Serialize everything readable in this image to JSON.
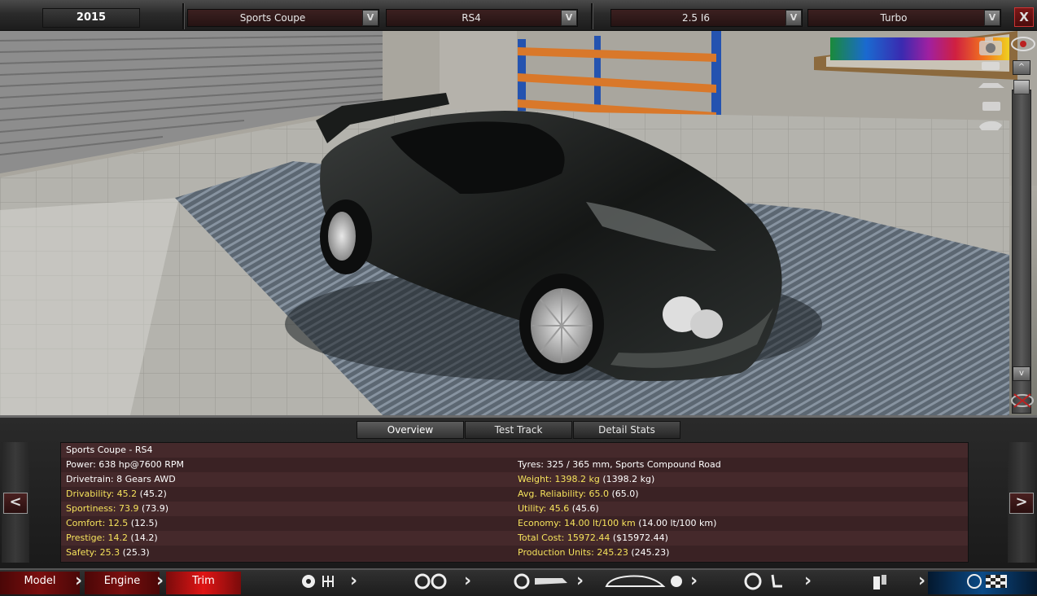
{
  "topbar": {
    "year": "2015",
    "selects": [
      {
        "value": "Sports Coupe",
        "arrow": "V"
      },
      {
        "value": "RS4",
        "arrow": "V"
      },
      {
        "value": "2.5 I6",
        "arrow": "V"
      },
      {
        "value": "Turbo",
        "arrow": "V"
      }
    ],
    "close_label": "X"
  },
  "scene": {
    "rail_up": "^",
    "rail_down": "v",
    "icons": [
      "camera-icon",
      "car-front-icon",
      "car-side-icon",
      "car-rear-icon",
      "car-top-icon",
      "eye-icon",
      "eye-off-icon"
    ]
  },
  "panel": {
    "tabs": [
      "Overview",
      "Test Track",
      "Detail Stats"
    ],
    "prev_label": "<",
    "next_label": ">",
    "left_rows": [
      {
        "label": "Sports Coupe - RS4",
        "value": "",
        "extra": "",
        "highlight": false
      },
      {
        "label": "Power: 638 hp@7600 RPM",
        "value": "",
        "extra": "",
        "highlight": false
      },
      {
        "label": "Drivetrain: 8 Gears AWD",
        "value": "",
        "extra": "",
        "highlight": false
      },
      {
        "label": "Drivability: 45.2",
        "value": "",
        "extra": " (45.2)",
        "highlight": true
      },
      {
        "label": "Sportiness: 73.9",
        "value": "",
        "extra": " (73.9)",
        "highlight": true
      },
      {
        "label": "Comfort: 12.5",
        "value": "",
        "extra": " (12.5)",
        "highlight": true
      },
      {
        "label": "Prestige: 14.2",
        "value": "",
        "extra": " (14.2)",
        "highlight": true
      },
      {
        "label": "Safety: 25.3",
        "value": "",
        "extra": " (25.3)",
        "highlight": true
      }
    ],
    "right_rows": [
      {
        "label": "",
        "extra": "",
        "highlight": false
      },
      {
        "label": "Tyres: 325 / 365 mm, Sports Compound Road",
        "extra": "",
        "highlight": false
      },
      {
        "label": "Weight: 1398.2 kg",
        "extra": " (1398.2 kg)",
        "highlight": true
      },
      {
        "label": "Avg. Reliability: 65.0",
        "extra": " (65.0)",
        "highlight": true
      },
      {
        "label": "Utility: 45.6",
        "extra": " (45.6)",
        "highlight": true
      },
      {
        "label": "Economy: 14.00 lt/100 km",
        "extra": " (14.00 lt/100 km)",
        "highlight": true
      },
      {
        "label": "Total Cost: 15972.44",
        "extra": " ($15972.44)",
        "highlight": true
      },
      {
        "label": "Production Units: 245.23",
        "extra": " (245.23)",
        "highlight": true
      }
    ]
  },
  "bottombar": {
    "tabs": [
      {
        "label": "Model",
        "style": "red"
      },
      {
        "label": "Engine",
        "style": "red"
      },
      {
        "label": "Trim",
        "style": "redhi"
      }
    ],
    "icon_groups": [
      [
        "gear-icon",
        "gearbox-icon"
      ],
      [
        "wheel-icon",
        "wheel-icon"
      ],
      [
        "brake-icon",
        "chassis-icon"
      ],
      [
        "car-body-icon",
        "fan-icon"
      ],
      [
        "steering-wheel-icon",
        "seat-icon"
      ],
      [
        "spray-icon",
        "exhaust-icon"
      ],
      [
        "speedometer-icon",
        "checkered-flag-icon"
      ]
    ]
  },
  "colors": {
    "accent_red": "#7a0e0e",
    "highlight_yellow": "#f5e25c",
    "stats_bg": "#3c2426",
    "active_blue": "#0b4a86"
  }
}
